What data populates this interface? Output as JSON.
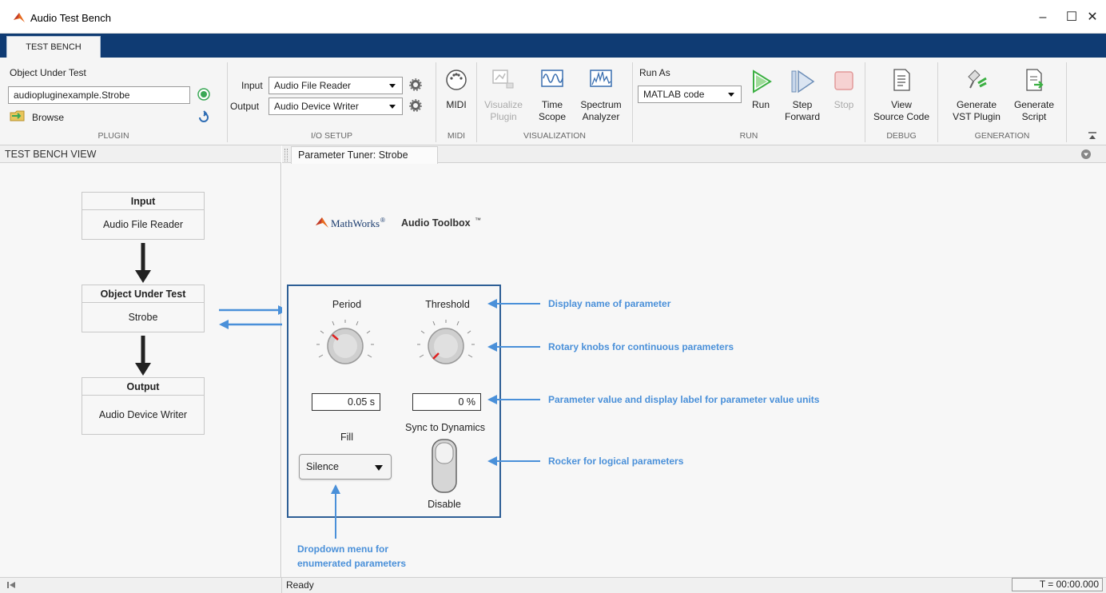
{
  "window": {
    "title": "Audio Test Bench",
    "minimize": "–",
    "maximize": "☐",
    "close": "✕"
  },
  "tabs": {
    "test_bench": "TEST BENCH"
  },
  "plugin": {
    "object_label": "Object Under Test",
    "object_value": "audiopluginexample.Strobe",
    "browse_label": "Browse",
    "group_label": "PLUGIN"
  },
  "io_setup": {
    "input_label": "Input",
    "input_value": "Audio File Reader",
    "output_label": "Output",
    "output_value": "Audio Device Writer",
    "group_label": "I/O SETUP"
  },
  "midi": {
    "button_label": "MIDI",
    "group_label": "MIDI"
  },
  "visualization": {
    "visualize_line1": "Visualize",
    "visualize_line2": "Plugin",
    "time_line1": "Time",
    "time_line2": "Scope",
    "spectrum_line1": "Spectrum",
    "spectrum_line2": "Analyzer",
    "group_label": "VISUALIZATION"
  },
  "run": {
    "run_as_label": "Run As",
    "run_as_value": "MATLAB code",
    "run_label": "Run",
    "step_line1": "Step",
    "step_line2": "Forward",
    "stop_label": "Stop",
    "group_label": "RUN"
  },
  "debug": {
    "view_line1": "View",
    "view_line2": "Source Code",
    "group_label": "DEBUG"
  },
  "generation": {
    "vst_line1": "Generate",
    "vst_line2": "VST Plugin",
    "script_line1": "Generate",
    "script_line2": "Script",
    "group_label": "GENERATION"
  },
  "test_bench_view": {
    "header": "TEST BENCH VIEW",
    "input_title": "Input",
    "input_value": "Audio File Reader",
    "object_title": "Object Under Test",
    "object_value": "Strobe",
    "output_title": "Output",
    "output_value": "Audio Device Writer"
  },
  "param_tuner": {
    "tab_label": "Parameter Tuner: Strobe",
    "brand": "MathWorks",
    "product": "Audio Toolbox",
    "tm": "™",
    "period_label": "Period",
    "threshold_label": "Threshold",
    "period_value": "0.05 s",
    "threshold_value": "0 %",
    "fill_label": "Fill",
    "fill_value": "Silence",
    "sync_label": "Sync to Dynamics",
    "sync_state": "Disable"
  },
  "annotations": {
    "display_name": "Display name of parameter",
    "rotary": "Rotary knobs for continuous parameters",
    "value_units": "Parameter value and display label for parameter value units",
    "rocker": "Rocker for logical parameters",
    "dropdown_line1": "Dropdown menu for",
    "dropdown_line2": "enumerated parameters"
  },
  "status": {
    "text": "Ready",
    "time": "T = 00:00.000"
  },
  "colors": {
    "title_blue": "#0f3b73",
    "annotation": "#4a90d9",
    "box_border": "#2e5f96",
    "run_green": "#3cb043"
  }
}
